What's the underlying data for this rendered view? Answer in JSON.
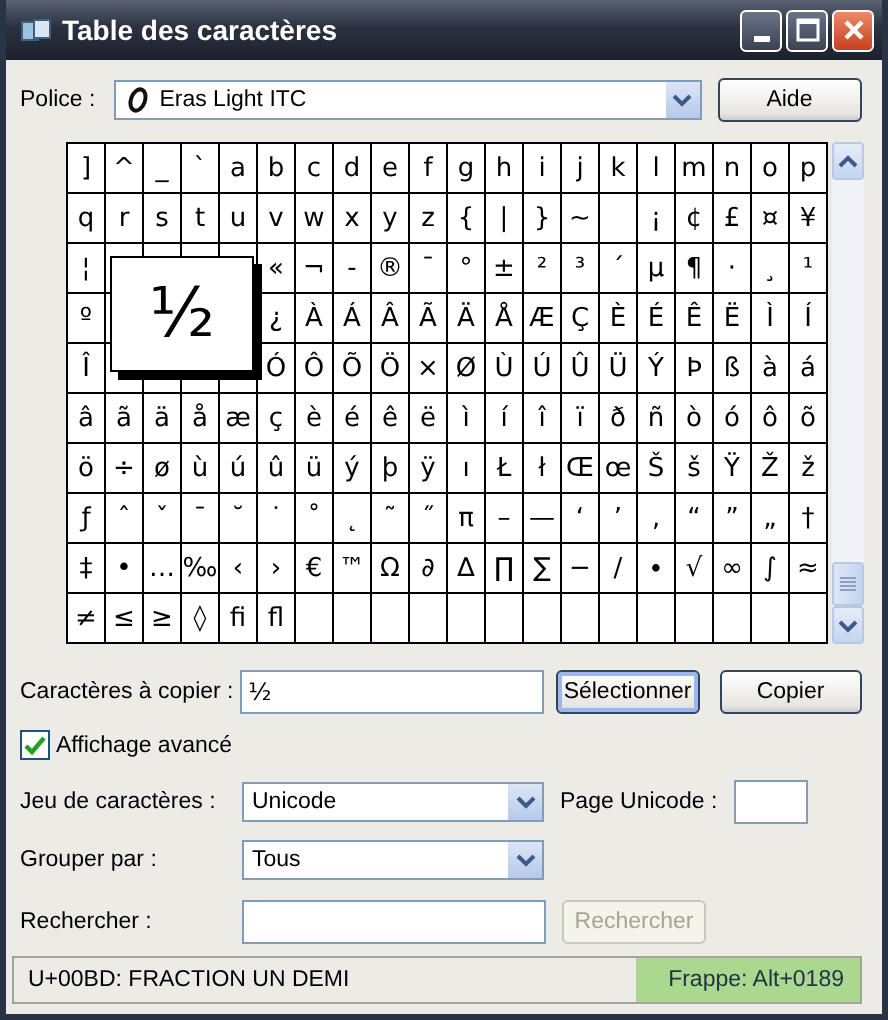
{
  "window": {
    "title": "Table des caractères"
  },
  "font": {
    "label": "Police :",
    "value": "Eras Light ITC"
  },
  "help_button": {
    "label": "Aide"
  },
  "grid": {
    "rows": [
      [
        "]",
        "^",
        "_",
        "`",
        "a",
        "b",
        "c",
        "d",
        "e",
        "f",
        "g",
        "h",
        "i",
        "j",
        "k",
        "l",
        "m",
        "n",
        "o",
        "p"
      ],
      [
        "q",
        "r",
        "s",
        "t",
        "u",
        "v",
        "w",
        "x",
        "y",
        "z",
        "{",
        "|",
        "}",
        "~",
        null,
        "¡",
        "¢",
        "£",
        "¤",
        "¥"
      ],
      [
        "¦",
        null,
        null,
        null,
        null,
        "«",
        "¬",
        "-",
        "®",
        "¯",
        "°",
        "±",
        "²",
        "³",
        "´",
        "µ",
        "¶",
        "·",
        "¸",
        "¹"
      ],
      [
        "º",
        null,
        null,
        null,
        null,
        "¿",
        "À",
        "Á",
        "Â",
        "Ã",
        "Ä",
        "Å",
        "Æ",
        "Ç",
        "È",
        "É",
        "Ê",
        "Ë",
        "Ì",
        "Í"
      ],
      [
        "Î",
        null,
        null,
        null,
        null,
        "Ó",
        "Ô",
        "Õ",
        "Ö",
        "×",
        "Ø",
        "Ù",
        "Ú",
        "Û",
        "Ü",
        "Ý",
        "Þ",
        "ß",
        "à",
        "á"
      ],
      [
        "â",
        "ã",
        "ä",
        "å",
        "æ",
        "ç",
        "è",
        "é",
        "ê",
        "ë",
        "ì",
        "í",
        "î",
        "ï",
        "ð",
        "ñ",
        "ò",
        "ó",
        "ô",
        "õ"
      ],
      [
        "ö",
        "÷",
        "ø",
        "ù",
        "ú",
        "û",
        "ü",
        "ý",
        "þ",
        "ÿ",
        "ı",
        "Ł",
        "ł",
        "Œ",
        "œ",
        "Š",
        "š",
        "Ÿ",
        "Ž",
        "ž"
      ],
      [
        "ƒ",
        "ˆ",
        "ˇ",
        "ˉ",
        "˘",
        "˙",
        "˚",
        "˛",
        "˜",
        "˝",
        "π",
        "–",
        "—",
        "‘",
        "’",
        "‚",
        "“",
        "”",
        "„",
        "†"
      ],
      [
        "‡",
        "•",
        "…",
        "‰",
        "‹",
        "›",
        "€",
        "™",
        "Ω",
        "∂",
        "∆",
        "∏",
        "∑",
        "−",
        "∕",
        "∙",
        "√",
        "∞",
        "∫",
        "≈"
      ],
      [
        "≠",
        "≤",
        "≥",
        "◊",
        "ﬁ",
        "ﬂ",
        null,
        null,
        null,
        null,
        null,
        null,
        null,
        null,
        null,
        null,
        null,
        null,
        null,
        null
      ]
    ],
    "magnifier": {
      "char": "½"
    }
  },
  "copy": {
    "label": "Caractères à copier :",
    "value": "½"
  },
  "buttons": [
    {
      "label": "Sélectionner",
      "focused": true
    },
    {
      "label": "Copier",
      "focused": false
    }
  ],
  "advanced": {
    "label": "Affichage avancé",
    "checked": true
  },
  "charset": {
    "label": "Jeu de caractères :",
    "value": "Unicode"
  },
  "unicode_page": {
    "label": "Page Unicode :"
  },
  "group_by": {
    "label": "Grouper par :",
    "value": "Tous"
  },
  "search": {
    "label": "Rechercher :"
  },
  "search_button": {
    "label": "Rechercher",
    "disabled": true
  },
  "status_bar": {
    "description": "U+00BD: FRACTION UN DEMI",
    "keystroke": "Frappe: Alt+0189"
  }
}
